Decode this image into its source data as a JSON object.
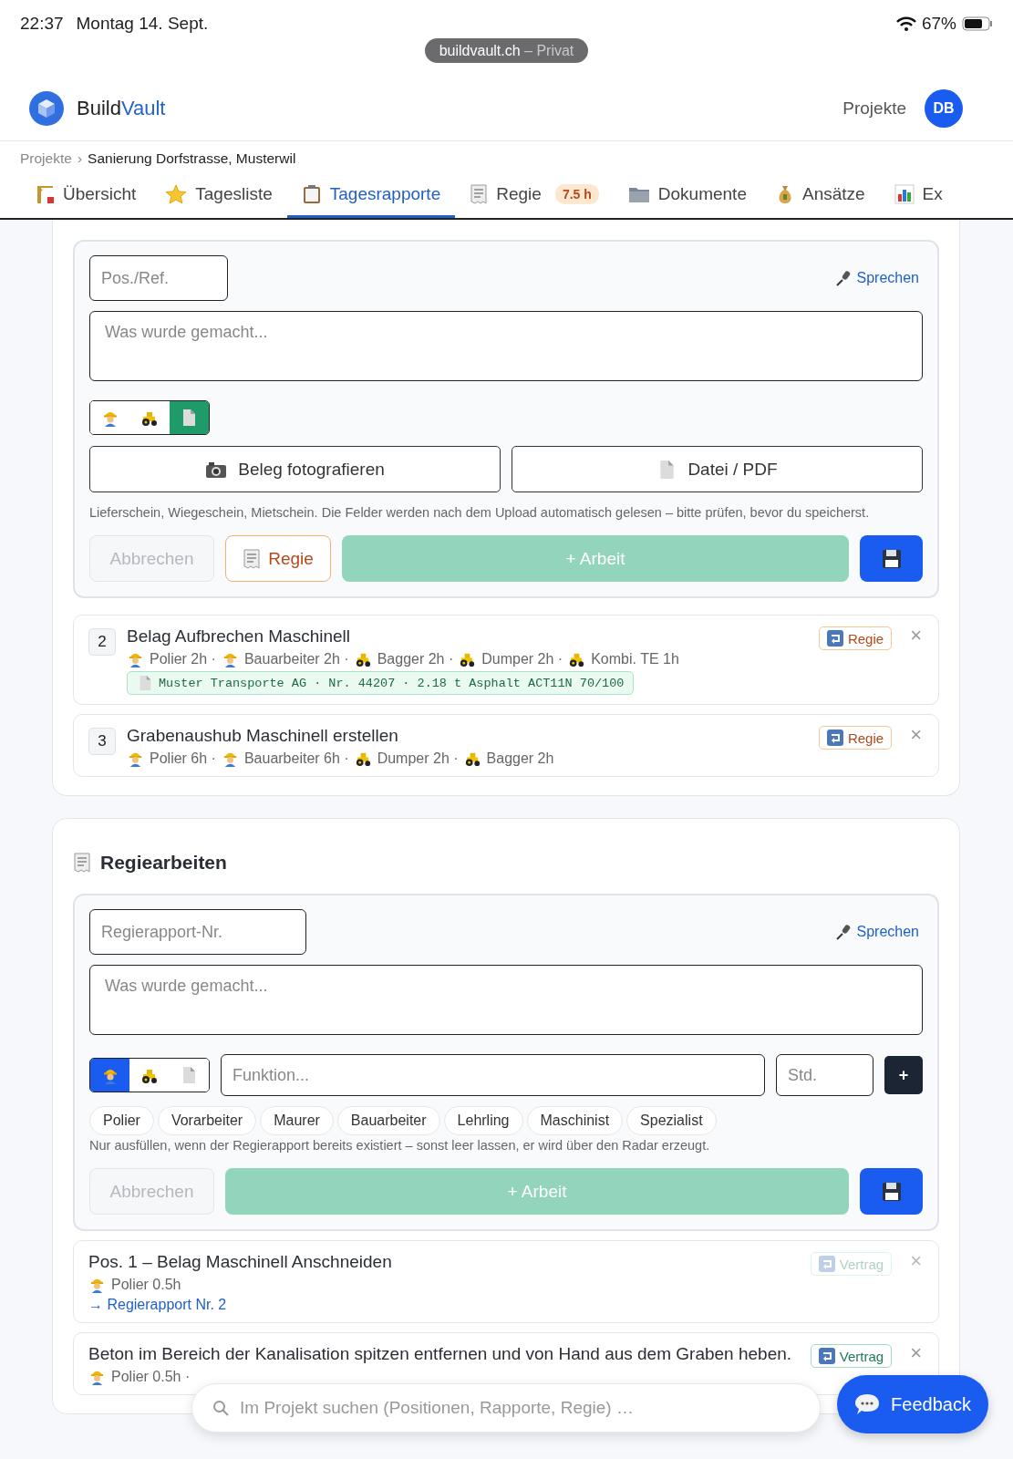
{
  "status_bar": {
    "time": "22:37",
    "date": "Montag 14. Sept.",
    "battery": "67%"
  },
  "url_pill": {
    "domain": "buildvault.ch",
    "mode": "– Privat"
  },
  "header": {
    "brand_first": "Build",
    "brand_second": "Vault",
    "nav": "Projekte",
    "avatar": "DB"
  },
  "breadcrumb": {
    "parent": "Projekte",
    "separator": "›",
    "current": "Sanierung Dorfstrasse, Musterwil"
  },
  "tabs": [
    {
      "label": "Übersicht",
      "selected": false
    },
    {
      "label": "Tagesliste",
      "selected": false
    },
    {
      "label": "Tagesrapporte",
      "selected": true
    },
    {
      "label": "Regie",
      "selected": false,
      "badge": "7.5 h"
    },
    {
      "label": "Dokumente",
      "selected": false
    },
    {
      "label": "Ansätze",
      "selected": false
    },
    {
      "label": "Ex",
      "selected": false
    }
  ],
  "sections": [
    {
      "form": {
        "ref_placeholder": "Pos./Ref.",
        "speak": "Sprechen",
        "desc_placeholder": "Was wurde gemacht...",
        "modes": [
          {
            "kind": "worker",
            "selected": false
          },
          {
            "kind": "machine",
            "selected": false
          },
          {
            "kind": "document",
            "selected": true
          }
        ],
        "uploads": [
          {
            "kind": "camera",
            "label": "Beleg fotografieren"
          },
          {
            "kind": "file",
            "label": "Datei / PDF"
          }
        ],
        "hint": "Lieferschein, Wiegeschein, Mietschein. Die Felder werden nach dem Upload automatisch gelesen – bitte prüfen, bevor du speicherst.",
        "actions": [
          {
            "kind": "cancel",
            "label": "Abbrechen",
            "disabled": true
          },
          {
            "kind": "regie",
            "label": "Regie"
          },
          {
            "kind": "add",
            "label": "+ Arbeit",
            "disabled": true
          },
          {
            "kind": "save"
          }
        ]
      },
      "entries": [
        {
          "number": "2",
          "title": "Belag Aufbrechen Maschinell",
          "resources": [
            {
              "kind": "worker",
              "text": "Polier 2h ·"
            },
            {
              "kind": "worker",
              "text": "Bauarbeiter 2h ·"
            },
            {
              "kind": "machine",
              "text": "Bagger 2h ·"
            },
            {
              "kind": "machine",
              "text": "Dumper 2h ·"
            },
            {
              "kind": "machine",
              "text": "Kombi. TE 1h"
            }
          ],
          "receipt": "Muster Transporte AG · Nr. 44207 · 2.18 t Asphalt ACT11N 70/100",
          "tag": {
            "kind": "regie",
            "label": "Regie",
            "disabled": false
          },
          "remove": "×"
        },
        {
          "number": "3",
          "title": "Grabenaushub Maschinell erstellen",
          "resources": [
            {
              "kind": "worker",
              "text": "Polier 6h ·"
            },
            {
              "kind": "worker",
              "text": "Bauarbeiter 6h ·"
            },
            {
              "kind": "machine",
              "text": "Dumper 2h ·"
            },
            {
              "kind": "machine",
              "text": "Bagger 2h"
            }
          ],
          "tag": {
            "kind": "regie",
            "label": "Regie",
            "disabled": false
          },
          "remove": "×"
        }
      ]
    },
    {
      "title": "Regiearbeiten",
      "form": {
        "ref_placeholder": "Regierapport-Nr.",
        "speak": "Sprechen",
        "desc_placeholder": "Was wurde gemacht...",
        "modes": [
          {
            "kind": "worker",
            "selected": true
          },
          {
            "kind": "machine",
            "selected": false
          },
          {
            "kind": "document",
            "selected": false
          }
        ],
        "resource_input": {
          "function_placeholder": "Funktion...",
          "hours_placeholder": "Std.",
          "add": "+"
        },
        "chips": [
          "Polier",
          "Vorarbeiter",
          "Maurer",
          "Bauarbeiter",
          "Lehrling",
          "Maschinist",
          "Spezialist"
        ],
        "hint": "Nur ausfüllen, wenn der Regierapport bereits existiert – sonst leer lassen, er wird über den Radar erzeugt.",
        "actions": [
          {
            "kind": "cancel",
            "label": "Abbrechen",
            "disabled": true
          },
          {
            "kind": "add",
            "label": "+ Arbeit",
            "disabled": true
          },
          {
            "kind": "save"
          }
        ]
      },
      "entries": [
        {
          "title": "Pos. 1 – Belag Maschinell Anschneiden",
          "resources": [
            {
              "kind": "worker",
              "text": "Polier 0.5h"
            }
          ],
          "link": "→ Regierapport Nr. 2",
          "tag": {
            "kind": "vertrag",
            "label": "Vertrag",
            "disabled": true
          },
          "remove": "×",
          "disabled": true
        },
        {
          "title": "Beton im Bereich der Kanalisation spitzen entfernen und von Hand aus dem Graben heben.",
          "resources": [
            {
              "kind": "worker",
              "text": "Polier 0.5h ·"
            }
          ],
          "tag": {
            "kind": "vertrag",
            "label": "Vertrag",
            "disabled": false
          },
          "remove": "×",
          "disabled": false
        }
      ]
    }
  ],
  "search": {
    "placeholder": "Im Projekt suchen (Positionen, Rapporte, Regie) …"
  },
  "feedback": {
    "label": "Feedback"
  }
}
